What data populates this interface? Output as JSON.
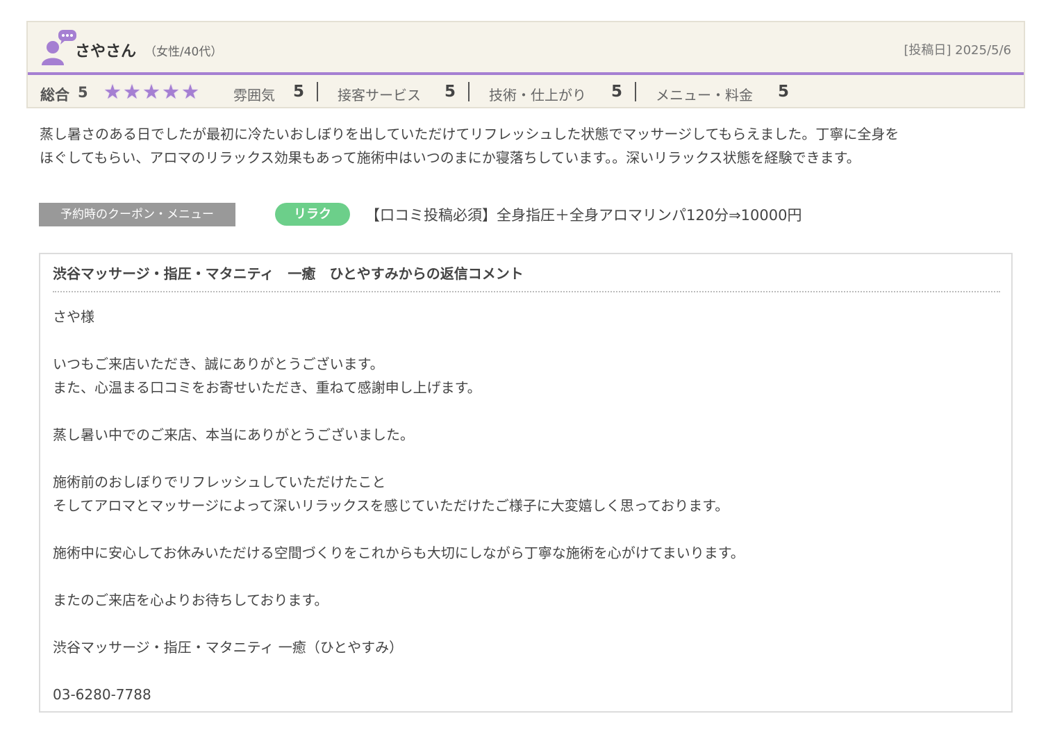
{
  "reviewer": {
    "name": "さやさん",
    "attributes": "（女性/40代）",
    "post_date": "[投稿日] 2025/5/6",
    "avatar_icon": "user-comment-icon"
  },
  "ratings": {
    "overall_label": "総合",
    "overall_score": "5",
    "stars": 5,
    "star_color": "#a57fd2",
    "sub": [
      {
        "label": "雰囲気",
        "value": "5"
      },
      {
        "label": "接客サービス",
        "value": "5"
      },
      {
        "label": "技術・仕上がり",
        "value": "5"
      },
      {
        "label": "メニュー・料金",
        "value": "5"
      }
    ]
  },
  "review": {
    "lines": [
      "蒸し暑さのある日でしたが最初に冷たいおしぼりを出していただけてリフレッシュした状態でマッサージしてもらえました。丁寧に全身を",
      "ほぐしてもらい、アロマのリラックス効果もあって施術中はいつのまにか寝落ちしています。。深いリラックス状態を経験できます。"
    ]
  },
  "coupon": {
    "label": "予約時のクーポン・メニュー",
    "badge": "リラク",
    "badge_color": "#6ccf8a",
    "text": "【口コミ投稿必須】全身指圧＋全身アロマリンパ120分⇒10000円"
  },
  "reply": {
    "title": "渋谷マッサージ・指圧・マタニティ　一癒　ひとやすみからの返信コメント",
    "lines": [
      "さや様",
      "",
      "いつもご来店いただき、誠にありがとうございます。",
      "また、心温まる口コミをお寄せいただき、重ねて感謝申し上げます。",
      "",
      "蒸し暑い中でのご来店、本当にありがとうございました。",
      "",
      "施術前のおしぼりでリフレッシュしていただけたこと",
      "そしてアロマとマッサージによって深いリラックスを感じていただけたご様子に大変嬉しく思っております。",
      "",
      "施術中に安心してお休みいただける空間づくりをこれからも大切にしながら丁寧な施術を心がけてまいります。",
      "",
      "またのご来店を心よりお待ちしております。",
      "",
      "渋谷マッサージ・指圧・マタニティ 一癒（ひとやすみ）",
      "",
      "03-6280-7788"
    ]
  }
}
